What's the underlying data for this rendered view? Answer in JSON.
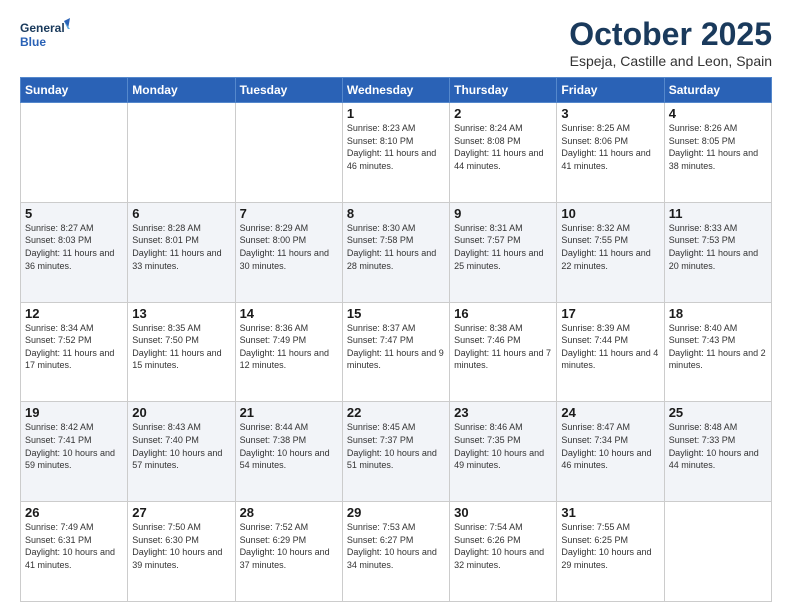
{
  "logo": {
    "line1": "General",
    "line2": "Blue"
  },
  "header": {
    "title": "October 2025",
    "subtitle": "Espeja, Castille and Leon, Spain"
  },
  "days_of_week": [
    "Sunday",
    "Monday",
    "Tuesday",
    "Wednesday",
    "Thursday",
    "Friday",
    "Saturday"
  ],
  "weeks": [
    [
      {
        "day": "",
        "sunrise": "",
        "sunset": "",
        "daylight": "",
        "empty": true
      },
      {
        "day": "",
        "sunrise": "",
        "sunset": "",
        "daylight": "",
        "empty": true
      },
      {
        "day": "",
        "sunrise": "",
        "sunset": "",
        "daylight": "",
        "empty": true
      },
      {
        "day": "1",
        "sunrise": "Sunrise: 8:23 AM",
        "sunset": "Sunset: 8:10 PM",
        "daylight": "Daylight: 11 hours and 46 minutes."
      },
      {
        "day": "2",
        "sunrise": "Sunrise: 8:24 AM",
        "sunset": "Sunset: 8:08 PM",
        "daylight": "Daylight: 11 hours and 44 minutes."
      },
      {
        "day": "3",
        "sunrise": "Sunrise: 8:25 AM",
        "sunset": "Sunset: 8:06 PM",
        "daylight": "Daylight: 11 hours and 41 minutes."
      },
      {
        "day": "4",
        "sunrise": "Sunrise: 8:26 AM",
        "sunset": "Sunset: 8:05 PM",
        "daylight": "Daylight: 11 hours and 38 minutes."
      }
    ],
    [
      {
        "day": "5",
        "sunrise": "Sunrise: 8:27 AM",
        "sunset": "Sunset: 8:03 PM",
        "daylight": "Daylight: 11 hours and 36 minutes."
      },
      {
        "day": "6",
        "sunrise": "Sunrise: 8:28 AM",
        "sunset": "Sunset: 8:01 PM",
        "daylight": "Daylight: 11 hours and 33 minutes."
      },
      {
        "day": "7",
        "sunrise": "Sunrise: 8:29 AM",
        "sunset": "Sunset: 8:00 PM",
        "daylight": "Daylight: 11 hours and 30 minutes."
      },
      {
        "day": "8",
        "sunrise": "Sunrise: 8:30 AM",
        "sunset": "Sunset: 7:58 PM",
        "daylight": "Daylight: 11 hours and 28 minutes."
      },
      {
        "day": "9",
        "sunrise": "Sunrise: 8:31 AM",
        "sunset": "Sunset: 7:57 PM",
        "daylight": "Daylight: 11 hours and 25 minutes."
      },
      {
        "day": "10",
        "sunrise": "Sunrise: 8:32 AM",
        "sunset": "Sunset: 7:55 PM",
        "daylight": "Daylight: 11 hours and 22 minutes."
      },
      {
        "day": "11",
        "sunrise": "Sunrise: 8:33 AM",
        "sunset": "Sunset: 7:53 PM",
        "daylight": "Daylight: 11 hours and 20 minutes."
      }
    ],
    [
      {
        "day": "12",
        "sunrise": "Sunrise: 8:34 AM",
        "sunset": "Sunset: 7:52 PM",
        "daylight": "Daylight: 11 hours and 17 minutes."
      },
      {
        "day": "13",
        "sunrise": "Sunrise: 8:35 AM",
        "sunset": "Sunset: 7:50 PM",
        "daylight": "Daylight: 11 hours and 15 minutes."
      },
      {
        "day": "14",
        "sunrise": "Sunrise: 8:36 AM",
        "sunset": "Sunset: 7:49 PM",
        "daylight": "Daylight: 11 hours and 12 minutes."
      },
      {
        "day": "15",
        "sunrise": "Sunrise: 8:37 AM",
        "sunset": "Sunset: 7:47 PM",
        "daylight": "Daylight: 11 hours and 9 minutes."
      },
      {
        "day": "16",
        "sunrise": "Sunrise: 8:38 AM",
        "sunset": "Sunset: 7:46 PM",
        "daylight": "Daylight: 11 hours and 7 minutes."
      },
      {
        "day": "17",
        "sunrise": "Sunrise: 8:39 AM",
        "sunset": "Sunset: 7:44 PM",
        "daylight": "Daylight: 11 hours and 4 minutes."
      },
      {
        "day": "18",
        "sunrise": "Sunrise: 8:40 AM",
        "sunset": "Sunset: 7:43 PM",
        "daylight": "Daylight: 11 hours and 2 minutes."
      }
    ],
    [
      {
        "day": "19",
        "sunrise": "Sunrise: 8:42 AM",
        "sunset": "Sunset: 7:41 PM",
        "daylight": "Daylight: 10 hours and 59 minutes."
      },
      {
        "day": "20",
        "sunrise": "Sunrise: 8:43 AM",
        "sunset": "Sunset: 7:40 PM",
        "daylight": "Daylight: 10 hours and 57 minutes."
      },
      {
        "day": "21",
        "sunrise": "Sunrise: 8:44 AM",
        "sunset": "Sunset: 7:38 PM",
        "daylight": "Daylight: 10 hours and 54 minutes."
      },
      {
        "day": "22",
        "sunrise": "Sunrise: 8:45 AM",
        "sunset": "Sunset: 7:37 PM",
        "daylight": "Daylight: 10 hours and 51 minutes."
      },
      {
        "day": "23",
        "sunrise": "Sunrise: 8:46 AM",
        "sunset": "Sunset: 7:35 PM",
        "daylight": "Daylight: 10 hours and 49 minutes."
      },
      {
        "day": "24",
        "sunrise": "Sunrise: 8:47 AM",
        "sunset": "Sunset: 7:34 PM",
        "daylight": "Daylight: 10 hours and 46 minutes."
      },
      {
        "day": "25",
        "sunrise": "Sunrise: 8:48 AM",
        "sunset": "Sunset: 7:33 PM",
        "daylight": "Daylight: 10 hours and 44 minutes."
      }
    ],
    [
      {
        "day": "26",
        "sunrise": "Sunrise: 7:49 AM",
        "sunset": "Sunset: 6:31 PM",
        "daylight": "Daylight: 10 hours and 41 minutes."
      },
      {
        "day": "27",
        "sunrise": "Sunrise: 7:50 AM",
        "sunset": "Sunset: 6:30 PM",
        "daylight": "Daylight: 10 hours and 39 minutes."
      },
      {
        "day": "28",
        "sunrise": "Sunrise: 7:52 AM",
        "sunset": "Sunset: 6:29 PM",
        "daylight": "Daylight: 10 hours and 37 minutes."
      },
      {
        "day": "29",
        "sunrise": "Sunrise: 7:53 AM",
        "sunset": "Sunset: 6:27 PM",
        "daylight": "Daylight: 10 hours and 34 minutes."
      },
      {
        "day": "30",
        "sunrise": "Sunrise: 7:54 AM",
        "sunset": "Sunset: 6:26 PM",
        "daylight": "Daylight: 10 hours and 32 minutes."
      },
      {
        "day": "31",
        "sunrise": "Sunrise: 7:55 AM",
        "sunset": "Sunset: 6:25 PM",
        "daylight": "Daylight: 10 hours and 29 minutes."
      },
      {
        "day": "",
        "sunrise": "",
        "sunset": "",
        "daylight": "",
        "empty": true
      }
    ]
  ]
}
